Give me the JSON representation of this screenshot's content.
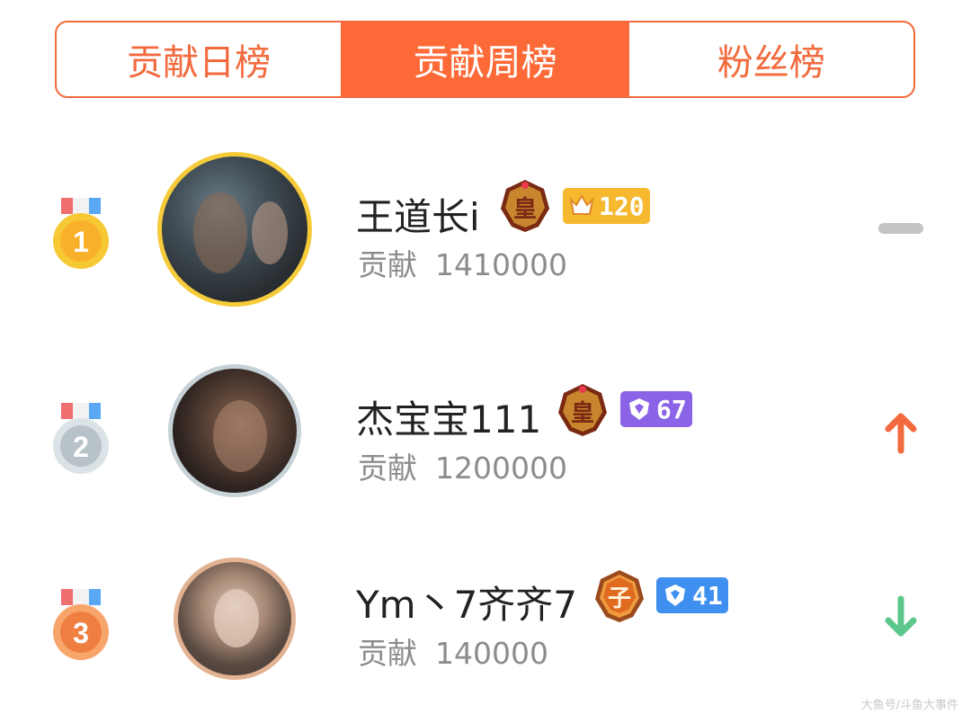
{
  "tabs": [
    {
      "label": "贡献日榜",
      "active": false
    },
    {
      "label": "贡献周榜",
      "active": true
    },
    {
      "label": "粉丝榜",
      "active": false
    }
  ],
  "contribution_label": "贡献",
  "rows": [
    {
      "rank": "1",
      "name": "王道长i",
      "noble_badge": "皇",
      "level": "120",
      "level_icon": "crown-level-icon",
      "contribution": "1410000",
      "trend": "unchanged",
      "avatar_ring": "#f6cb3a"
    },
    {
      "rank": "2",
      "name": "杰宝宝111",
      "noble_badge": "皇",
      "level": "67",
      "level_icon": "shield-level-icon",
      "contribution": "1200000",
      "trend": "up",
      "avatar_ring": "#c7d2d7"
    },
    {
      "rank": "3",
      "name": "Ym丶7齐齐7",
      "noble_badge": "子",
      "level": "41",
      "level_icon": "shield-level-icon",
      "contribution": "140000",
      "trend": "down",
      "avatar_ring": "#e2b293"
    }
  ],
  "colors": {
    "accent": "#fd6a37",
    "gold": "#f6c833",
    "silver": "#c5cdd2",
    "bronze": "#f08a4b",
    "trend_up": "#f26a3d",
    "trend_down": "#5bc78a",
    "trend_flat": "#c4c4c4",
    "level_gold": "#f5b82e",
    "level_purple": "#8a63e6",
    "level_blue": "#3f8ff0"
  },
  "watermark": "大鱼号/斗鱼大事件"
}
